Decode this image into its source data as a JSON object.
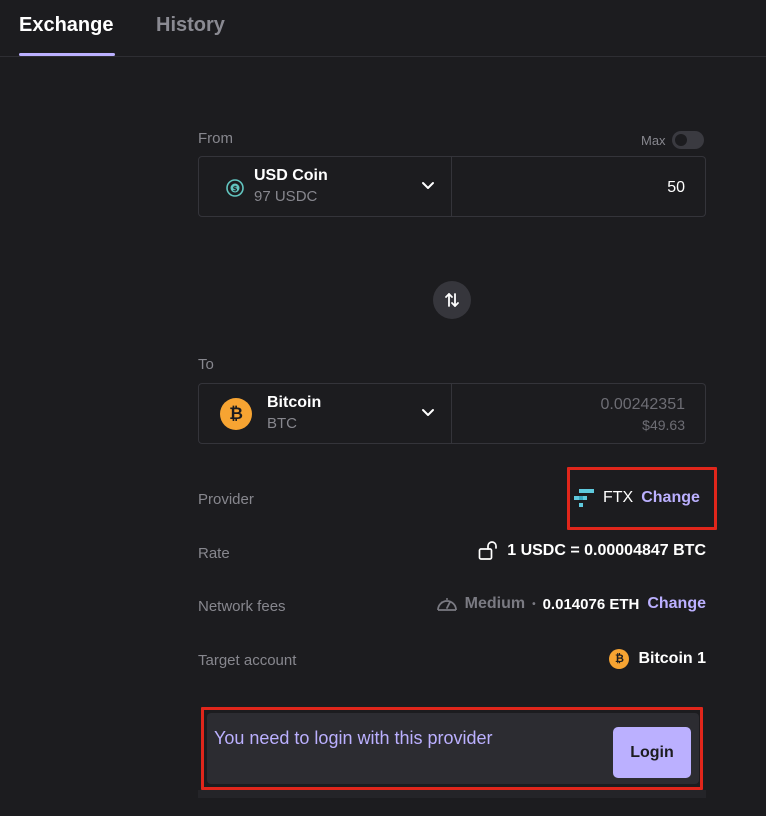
{
  "tabs": {
    "exchange": "Exchange",
    "history": "History"
  },
  "from": {
    "label": "From",
    "max_label": "Max",
    "coin_name": "USD Coin",
    "coin_balance": "97 USDC",
    "amount": "50",
    "icon": "usdc-icon"
  },
  "to": {
    "label": "To",
    "coin_name": "Bitcoin",
    "coin_ticker": "BTC",
    "amount": "0.00242351",
    "amount_fiat": "$49.63",
    "icon": "bitcoin-icon"
  },
  "provider": {
    "label": "Provider",
    "name": "FTX",
    "change_label": "Change"
  },
  "rate": {
    "label": "Rate",
    "value": "1 USDC = 0.00004847 BTC"
  },
  "fees": {
    "label": "Network fees",
    "speed": "Medium",
    "separator": "•",
    "value": "0.014076 ETH",
    "change_label": "Change"
  },
  "target": {
    "label": "Target account",
    "value": "Bitcoin 1"
  },
  "login": {
    "message": "You need to login with this provider",
    "button_label": "Login"
  },
  "colors": {
    "accent": "#bbb0ff",
    "background": "#1c1c1f",
    "highlight": "#e0261b",
    "bitcoin": "#f7a432"
  }
}
